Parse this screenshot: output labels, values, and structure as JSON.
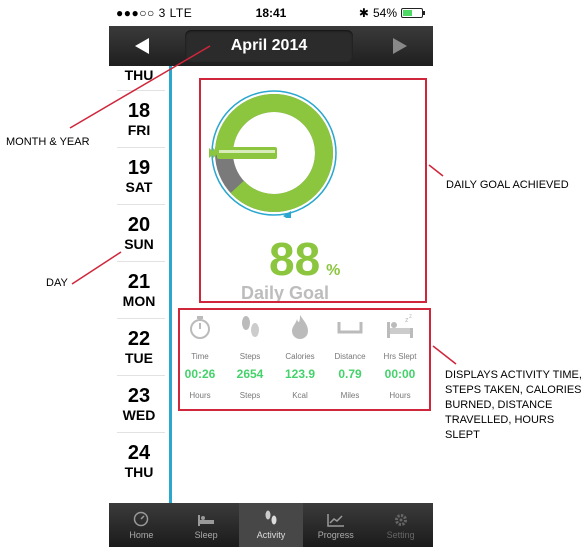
{
  "status_bar": {
    "carrier": "●●●○○ 3  LTE",
    "time": "18:41",
    "battery": "54%",
    "battery_level": 0.54
  },
  "header": {
    "month_year": "April 2014",
    "prev_icon": "left-triangle-icon",
    "next_icon": "right-triangle-icon"
  },
  "days": [
    {
      "num": "",
      "weekday": "THU"
    },
    {
      "num": "18",
      "weekday": "FRI"
    },
    {
      "num": "19",
      "weekday": "SAT"
    },
    {
      "num": "20",
      "weekday": "SUN"
    },
    {
      "num": "21",
      "weekday": "MON"
    },
    {
      "num": "22",
      "weekday": "TUE"
    },
    {
      "num": "23",
      "weekday": "WED"
    },
    {
      "num": "24",
      "weekday": "THU"
    }
  ],
  "goal": {
    "percent": "88",
    "percent_sign": "%",
    "label": "Daily Goal",
    "fraction": 0.88
  },
  "stats": [
    {
      "icon": "stopwatch-icon",
      "label": "Time",
      "value": "00:26",
      "unit": "Hours"
    },
    {
      "icon": "footprints-icon",
      "label": "Steps",
      "value": "2654",
      "unit": "Steps"
    },
    {
      "icon": "flame-icon",
      "label": "Calories",
      "value": "123.9",
      "unit": "Kcal"
    },
    {
      "icon": "ruler-icon",
      "label": "Distance",
      "value": "0.79",
      "unit": "Miles"
    },
    {
      "icon": "bed-icon",
      "label": "Hrs Slept",
      "value": "00:00",
      "unit": "Hours"
    }
  ],
  "tabs": [
    {
      "icon": "speedometer-icon",
      "label": "Home"
    },
    {
      "icon": "bed-icon",
      "label": "Sleep"
    },
    {
      "icon": "footprints-icon",
      "label": "Activity",
      "active": true
    },
    {
      "icon": "chart-icon",
      "label": "Progress"
    },
    {
      "icon": "gear-icon",
      "label": "Setting"
    }
  ],
  "annotations": {
    "month_year": "MONTH & YEAR",
    "day": "DAY",
    "daily_goal": "DAILY GOAL ACHIEVED",
    "displays": [
      "DISPLAYS ACTIVITY TIME,",
      "STEPS TAKEN, CALORIES",
      "BURNED, DISTANCE",
      "TRAVELLED, HOURS",
      "SLEPT"
    ]
  },
  "colors": {
    "accent_green": "#8cc63f",
    "value_green": "#45d16b",
    "blue": "#2aa6cf",
    "annotation_red": "#d0263b"
  }
}
